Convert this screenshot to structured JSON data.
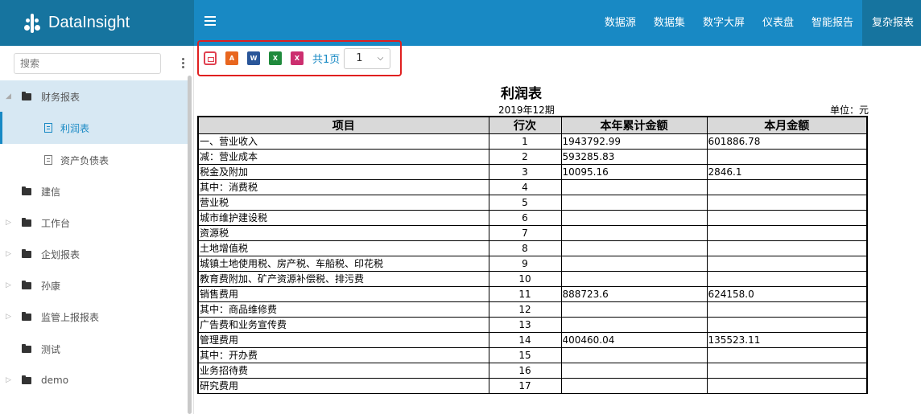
{
  "brand": {
    "name": "DataInsight"
  },
  "nav": {
    "items": [
      "数据源",
      "数据集",
      "数字大屏",
      "仪表盘",
      "智能报告",
      "复杂报表"
    ],
    "active_index": 5
  },
  "sidebar": {
    "search_placeholder": "搜索",
    "items": [
      {
        "label": "财务报表",
        "level": 0,
        "expanded": true
      },
      {
        "label": "利润表",
        "level": 1,
        "selected": true
      },
      {
        "label": "资产负债表",
        "level": 1
      },
      {
        "label": "建信",
        "level": 0
      },
      {
        "label": "工作台",
        "level": 0
      },
      {
        "label": "企划报表",
        "level": 0
      },
      {
        "label": "孙康",
        "level": 0
      },
      {
        "label": "监管上报报表",
        "level": 0
      },
      {
        "label": "测试",
        "level": 0
      },
      {
        "label": "demo",
        "level": 0
      }
    ]
  },
  "toolbar": {
    "page_total": "共1页",
    "page_select_value": "1"
  },
  "report": {
    "title": "利润表",
    "period": "2019年12期",
    "unit": "单位：元",
    "headers": [
      "项目",
      "行次",
      "本年累计金额",
      "本月金额"
    ],
    "rows": [
      [
        "一、营业收入",
        "1",
        "1943792.99",
        "601886.78"
      ],
      [
        "减：营业成本",
        "2",
        "593285.83",
        ""
      ],
      [
        "税金及附加",
        "3",
        "10095.16",
        "2846.1"
      ],
      [
        "其中：消费税",
        "4",
        "",
        ""
      ],
      [
        "营业税",
        "5",
        "",
        ""
      ],
      [
        "城市维护建设税",
        "6",
        "",
        ""
      ],
      [
        "资源税",
        "7",
        "",
        ""
      ],
      [
        "土地增值税",
        "8",
        "",
        ""
      ],
      [
        "城镇土地使用税、房产税、车船税、印花税",
        "9",
        "",
        ""
      ],
      [
        "教育费附加、矿产资源补偿税、排污费",
        "10",
        "",
        ""
      ],
      [
        "销售费用",
        "11",
        "888723.6",
        "624158.0"
      ],
      [
        "其中：商品维修费",
        "12",
        "",
        ""
      ],
      [
        "广告费和业务宣传费",
        "13",
        "",
        ""
      ],
      [
        "管理费用",
        "14",
        "400460.04",
        "135523.11"
      ],
      [
        "其中：开办费",
        "15",
        "",
        ""
      ],
      [
        "业务招待费",
        "16",
        "",
        ""
      ],
      [
        "研究费用",
        "17",
        "",
        ""
      ]
    ]
  }
}
